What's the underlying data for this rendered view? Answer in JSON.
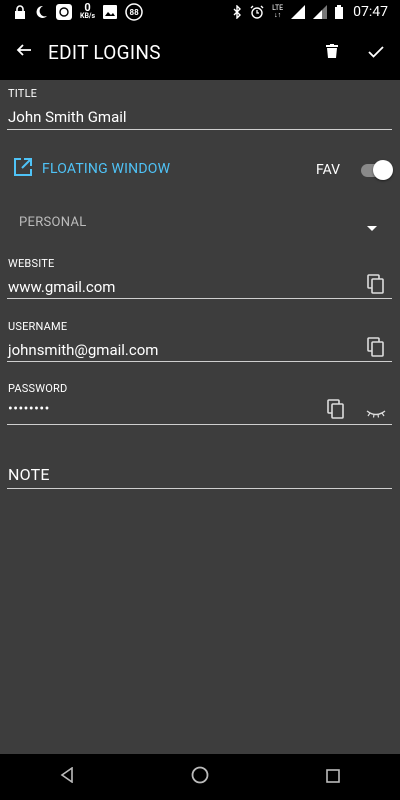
{
  "status_bar": {
    "speed_value": "0",
    "speed_unit": "KB/s",
    "notification_count": "88",
    "network": "LTE",
    "time": "07:47"
  },
  "app_bar": {
    "title": "EDIT LOGINS"
  },
  "form": {
    "title_label": "TITLE",
    "title_value": "John Smith Gmail",
    "floating_window_label": "FLOATING WINDOW",
    "fav_label": "FAV",
    "fav_on": true,
    "category": "PERSONAL",
    "website_label": "WEBSITE",
    "website_value": "www.gmail.com",
    "username_label": "USERNAME",
    "username_value": "johnsmith@gmail.com",
    "password_label": "PASSWORD",
    "password_value": "••••••••",
    "note_label": "NOTE"
  },
  "colors": {
    "background": "#3d3d3d",
    "bars": "#000000",
    "accent": "#4fc3f7"
  }
}
